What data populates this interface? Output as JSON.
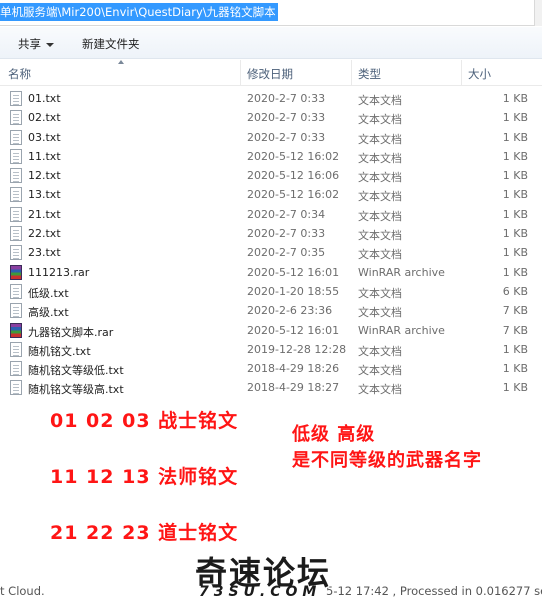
{
  "address": {
    "path": "单机服务端\\Mir200\\Envir\\QuestDiary\\九器铭文脚本"
  },
  "toolbar": {
    "share_label": "共享",
    "new_folder_label": "新建文件夹"
  },
  "columns": {
    "name": "名称",
    "date": "修改日期",
    "type": "类型",
    "size": "大小"
  },
  "files": [
    {
      "name": "01.txt",
      "date": "2020-2-7 0:33",
      "type": "文本文档",
      "size": "1 KB",
      "icon": "text-file-icon"
    },
    {
      "name": "02.txt",
      "date": "2020-2-7 0:33",
      "type": "文本文档",
      "size": "1 KB",
      "icon": "text-file-icon"
    },
    {
      "name": "03.txt",
      "date": "2020-2-7 0:33",
      "type": "文本文档",
      "size": "1 KB",
      "icon": "text-file-icon"
    },
    {
      "name": "11.txt",
      "date": "2020-5-12 16:02",
      "type": "文本文档",
      "size": "1 KB",
      "icon": "text-file-icon"
    },
    {
      "name": "12.txt",
      "date": "2020-5-12 16:06",
      "type": "文本文档",
      "size": "1 KB",
      "icon": "text-file-icon"
    },
    {
      "name": "13.txt",
      "date": "2020-5-12 16:02",
      "type": "文本文档",
      "size": "1 KB",
      "icon": "text-file-icon"
    },
    {
      "name": "21.txt",
      "date": "2020-2-7 0:34",
      "type": "文本文档",
      "size": "1 KB",
      "icon": "text-file-icon"
    },
    {
      "name": "22.txt",
      "date": "2020-2-7 0:33",
      "type": "文本文档",
      "size": "1 KB",
      "icon": "text-file-icon"
    },
    {
      "name": "23.txt",
      "date": "2020-2-7 0:35",
      "type": "文本文档",
      "size": "1 KB",
      "icon": "text-file-icon"
    },
    {
      "name": "111213.rar",
      "date": "2020-5-12 16:01",
      "type": "WinRAR archive",
      "size": "1 KB",
      "icon": "rar-archive-icon"
    },
    {
      "name": "低级.txt",
      "date": "2020-1-20 18:55",
      "type": "文本文档",
      "size": "6 KB",
      "icon": "text-file-icon"
    },
    {
      "name": "高级.txt",
      "date": "2020-2-6 23:36",
      "type": "文本文档",
      "size": "7 KB",
      "icon": "text-file-icon"
    },
    {
      "name": "九器铭文脚本.rar",
      "date": "2020-5-12 16:01",
      "type": "WinRAR archive",
      "size": "7 KB",
      "icon": "rar-archive-icon"
    },
    {
      "name": "随机铭文.txt",
      "date": "2019-12-28 12:28",
      "type": "文本文档",
      "size": "1 KB",
      "icon": "text-file-icon"
    },
    {
      "name": "随机铭文等级低.txt",
      "date": "2018-4-29 18:26",
      "type": "文本文档",
      "size": "1 KB",
      "icon": "text-file-icon"
    },
    {
      "name": "随机铭文等级高.txt",
      "date": "2018-4-29 18:27",
      "type": "文本文档",
      "size": "1 KB",
      "icon": "text-file-icon"
    }
  ],
  "annotations": {
    "line1": "01 02 03 战士铭文",
    "line2": "11 12 13 法师铭文",
    "line3": "21 22 23 道士铭文",
    "right1": "低级 高级",
    "right2": "是不同等级的武器名字",
    "color": "#ff1515"
  },
  "footer": {
    "left": "t Cloud.",
    "right": "5-12 17:42 , Processed in 0.016277 se"
  },
  "watermark": {
    "main": "奇速论坛",
    "sub": "73SU.COM"
  },
  "colors": {
    "selection": "#3399ff",
    "header_text": "#4c607a"
  }
}
